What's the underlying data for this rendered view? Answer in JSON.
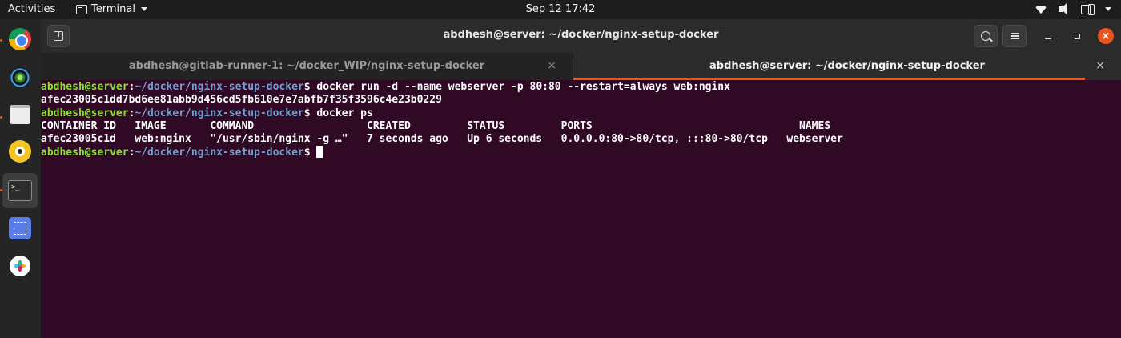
{
  "topbar": {
    "activities": "Activities",
    "app_name": "Terminal",
    "clock": "Sep 12  17:42",
    "icons": [
      "wifi-icon",
      "speaker-icon",
      "battery-icon",
      "chevron-down-icon"
    ]
  },
  "dock": {
    "items": [
      {
        "name": "chrome",
        "icon": "chrome-icon",
        "running": true
      },
      {
        "name": "shotwell",
        "icon": "photo-viewer-icon",
        "running": false
      },
      {
        "name": "files",
        "icon": "files-icon",
        "running": true
      },
      {
        "name": "rhythmbox",
        "icon": "music-player-icon",
        "running": false
      },
      {
        "name": "terminal",
        "icon": "terminal-icon",
        "running": true,
        "active": true
      },
      {
        "name": "screenshot",
        "icon": "screenshot-icon",
        "running": false
      },
      {
        "name": "slack",
        "icon": "slack-icon",
        "running": false
      }
    ],
    "terminal_glyph": ">_"
  },
  "window": {
    "title": "abdhesh@server: ~/docker/nginx-setup-docker",
    "close_glyph": "×",
    "tab_close_glyph": "×",
    "accent_color": "#e95420"
  },
  "tabs": [
    {
      "label": "abdhesh@gitlab-runner-1: ~/docker_WIP/nginx-setup-docker",
      "active": false
    },
    {
      "label": "abdhesh@server: ~/docker/nginx-setup-docker",
      "active": true
    }
  ],
  "terminal": {
    "background": "#300a24",
    "prompt_user": "abdhesh@server",
    "prompt_sep": ":",
    "prompt_path": "~/docker/nginx-setup-docker",
    "prompt_end": "$ ",
    "cmd1": "docker run -d --name webserver -p 80:80 --restart=always web:nginx",
    "out1": "afec23005c1dd7bd6ee81abb9d456cd5fb610e7e7abfb7f35f3596c4e23b0229",
    "cmd2": "docker ps",
    "ps_header": "CONTAINER ID   IMAGE       COMMAND                  CREATED         STATUS         PORTS                                 NAMES",
    "ps_row": "afec23005c1d   web:nginx   \"/usr/sbin/nginx -g …\"   7 seconds ago   Up 6 seconds   0.0.0.0:80->80/tcp, :::80->80/tcp   webserver"
  }
}
